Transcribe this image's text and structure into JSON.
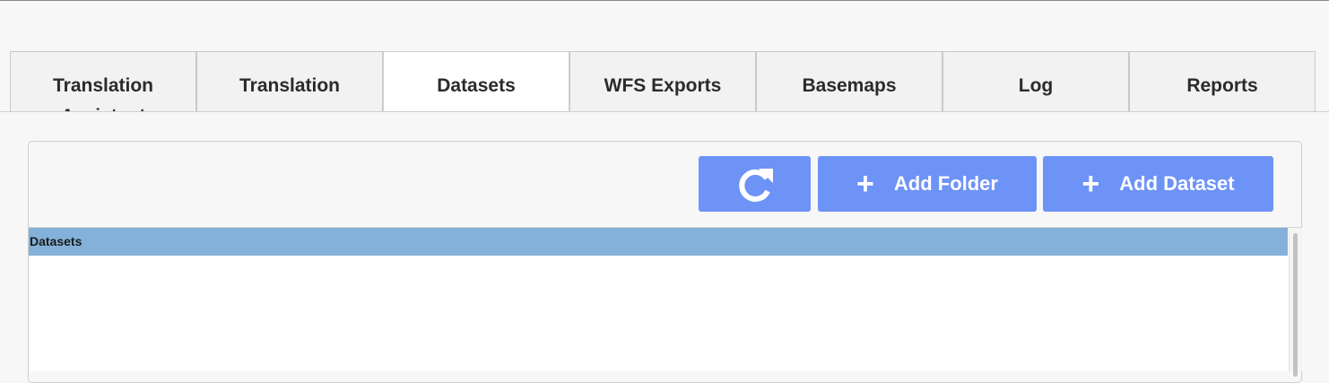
{
  "tabs": [
    {
      "label": "Translation Assistant",
      "active": false
    },
    {
      "label": "Translation",
      "active": false
    },
    {
      "label": "Datasets",
      "active": true
    },
    {
      "label": "WFS Exports",
      "active": false
    },
    {
      "label": "Basemaps",
      "active": false
    },
    {
      "label": "Log",
      "active": false
    },
    {
      "label": "Reports",
      "active": false
    }
  ],
  "toolbar": {
    "refresh_icon": "refresh-icon",
    "add_folder_label": "Add Folder",
    "add_dataset_label": "Add Dataset",
    "plus_glyph": "+"
  },
  "grid": {
    "header_label": "Datasets",
    "rows": []
  },
  "colors": {
    "button_bg": "#6e93f7",
    "grid_header_bg": "#83b1d9"
  }
}
